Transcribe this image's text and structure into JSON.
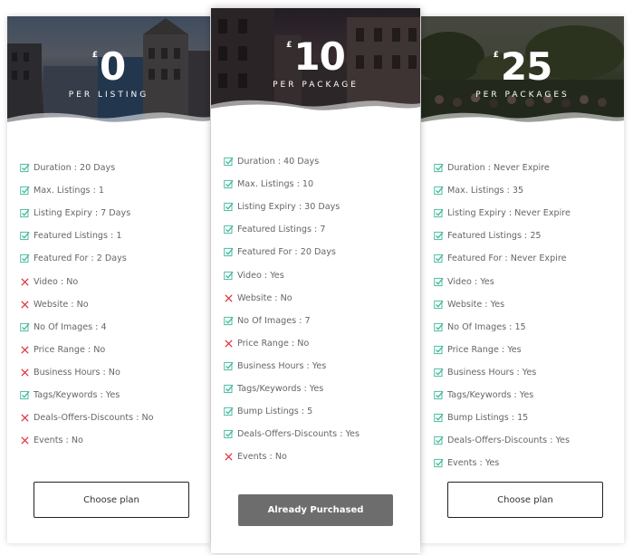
{
  "plans": [
    {
      "currency": "£",
      "amount": "0",
      "per": "PER LISTING",
      "button": "Choose plan",
      "features": [
        {
          "text": "Duration : 20 Days",
          "included": true
        },
        {
          "text": "Max. Listings : 1",
          "included": true
        },
        {
          "text": "Listing Expiry : 7 Days",
          "included": true
        },
        {
          "text": "Featured Listings : 1",
          "included": true
        },
        {
          "text": "Featured For : 2 Days",
          "included": true
        },
        {
          "text": "Video : No",
          "included": false
        },
        {
          "text": "Website : No",
          "included": false
        },
        {
          "text": "No Of Images : 4",
          "included": true
        },
        {
          "text": "Price Range : No",
          "included": false
        },
        {
          "text": "Business Hours : No",
          "included": false
        },
        {
          "text": "Tags/Keywords : Yes",
          "included": true
        },
        {
          "text": "Deals-Offers-Discounts : No",
          "included": false
        },
        {
          "text": "Events : No",
          "included": false
        }
      ]
    },
    {
      "currency": "£",
      "amount": "10",
      "per": "PER PACKAGE",
      "button": "Already Purchased",
      "features": [
        {
          "text": "Duration : 40 Days",
          "included": true
        },
        {
          "text": "Max. Listings : 10",
          "included": true
        },
        {
          "text": "Listing Expiry : 30 Days",
          "included": true
        },
        {
          "text": "Featured Listings : 7",
          "included": true
        },
        {
          "text": "Featured For : 20 Days",
          "included": true
        },
        {
          "text": "Video : Yes",
          "included": true
        },
        {
          "text": "Website : No",
          "included": false
        },
        {
          "text": "No Of Images : 7",
          "included": true
        },
        {
          "text": "Price Range : No",
          "included": false
        },
        {
          "text": "Business Hours : Yes",
          "included": true
        },
        {
          "text": "Tags/Keywords : Yes",
          "included": true
        },
        {
          "text": "Bump Listings : 5",
          "included": true
        },
        {
          "text": "Deals-Offers-Discounts : Yes",
          "included": true
        },
        {
          "text": "Events : No",
          "included": false
        }
      ]
    },
    {
      "currency": "£",
      "amount": "25",
      "per": "PER PACKAGES",
      "button": "Choose plan",
      "features": [
        {
          "text": "Duration : Never Expire",
          "included": true
        },
        {
          "text": "Max. Listings : 35",
          "included": true
        },
        {
          "text": "Listing Expiry : Never Expire",
          "included": true
        },
        {
          "text": "Featured Listings : 25",
          "included": true
        },
        {
          "text": "Featured For : Never Expire",
          "included": true
        },
        {
          "text": "Video : Yes",
          "included": true
        },
        {
          "text": "Website : Yes",
          "included": true
        },
        {
          "text": "No Of Images : 15",
          "included": true
        },
        {
          "text": "Price Range : Yes",
          "included": true
        },
        {
          "text": "Business Hours : Yes",
          "included": true
        },
        {
          "text": "Tags/Keywords : Yes",
          "included": true
        },
        {
          "text": "Bump Listings : 15",
          "included": true
        },
        {
          "text": "Deals-Offers-Discounts : Yes",
          "included": true
        },
        {
          "text": "Events : Yes",
          "included": true
        }
      ]
    }
  ],
  "icons": {
    "included": "check-square-icon",
    "excluded": "cross-icon"
  },
  "colors": {
    "check": "#3cb89a",
    "cross": "#e0303a",
    "purchased_button": "#6d6d6d"
  }
}
